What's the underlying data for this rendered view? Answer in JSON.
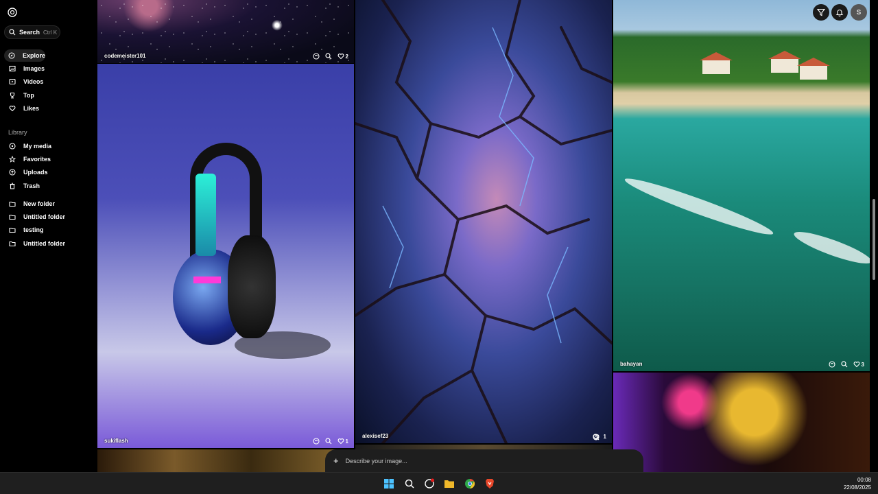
{
  "sidebar": {
    "search": {
      "label": "Search",
      "shortcut": "Ctrl K"
    },
    "nav": [
      {
        "label": "Explore",
        "icon": "compass-icon"
      },
      {
        "label": "Images",
        "icon": "image-icon"
      },
      {
        "label": "Videos",
        "icon": "video-icon"
      },
      {
        "label": "Top",
        "icon": "trophy-icon"
      },
      {
        "label": "Likes",
        "icon": "heart-icon"
      }
    ],
    "library_label": "Library",
    "library": [
      {
        "label": "My media",
        "icon": "media-icon"
      },
      {
        "label": "Favorites",
        "icon": "star-icon"
      },
      {
        "label": "Uploads",
        "icon": "upload-icon"
      },
      {
        "label": "Trash",
        "icon": "trash-icon"
      }
    ],
    "folders": [
      {
        "label": "New folder"
      },
      {
        "label": "Untitled folder"
      },
      {
        "label": "testing"
      },
      {
        "label": "Untitled folder"
      }
    ]
  },
  "tiles": [
    {
      "user": "codemeister101",
      "likes": "2"
    },
    {
      "user": "sukiflash",
      "likes": "1"
    },
    {
      "user": "alexisef23",
      "likes": "1"
    },
    {
      "user": "bahayan",
      "likes": "3"
    }
  ],
  "topbar": {
    "avatar_initial": "S"
  },
  "prompt": {
    "placeholder": "Describe your image..."
  },
  "taskbar": {
    "time": "00:08",
    "date": "22/08/2025"
  },
  "colors": {
    "background": "#000000",
    "taskbar": "#1f1f1f",
    "brave": "#e8472a",
    "files": "#f0b82a"
  }
}
